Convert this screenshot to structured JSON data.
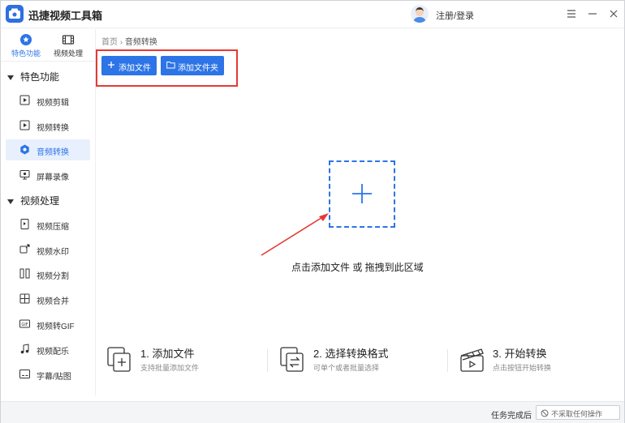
{
  "app": {
    "title": "迅捷视频工具箱",
    "login": "注册/登录"
  },
  "topnav": {
    "featured": "特色功能",
    "video": "视频处理"
  },
  "sidebar": {
    "sections": [
      {
        "title": "特色功能",
        "items": [
          "视频剪辑",
          "视频转换",
          "音频转换",
          "屏幕录像"
        ]
      },
      {
        "title": "视频处理",
        "items": [
          "视频压缩",
          "视频水印",
          "视频分割",
          "视频合并",
          "视频转GIF",
          "视频配乐",
          "字幕/贴图"
        ]
      }
    ]
  },
  "breadcrumb": {
    "home": "首页",
    "sep": "›",
    "current": "音频转换"
  },
  "toolbar": {
    "add_file": "添加文件",
    "add_folder": "添加文件夹"
  },
  "dropzone": {
    "hint": "点击添加文件 或 拖拽到此区域"
  },
  "steps": [
    {
      "title": "1. 添加文件",
      "desc": "支持批量添加文件"
    },
    {
      "title": "2. 选择转换格式",
      "desc": "可单个或者批量选择"
    },
    {
      "title": "3. 开始转换",
      "desc": "点击按钮开始转换"
    }
  ],
  "status": {
    "label": "任务完成后",
    "option": "不采取任何操作"
  },
  "colors": {
    "accent": "#2d74e7",
    "highlight": "#e53935"
  }
}
